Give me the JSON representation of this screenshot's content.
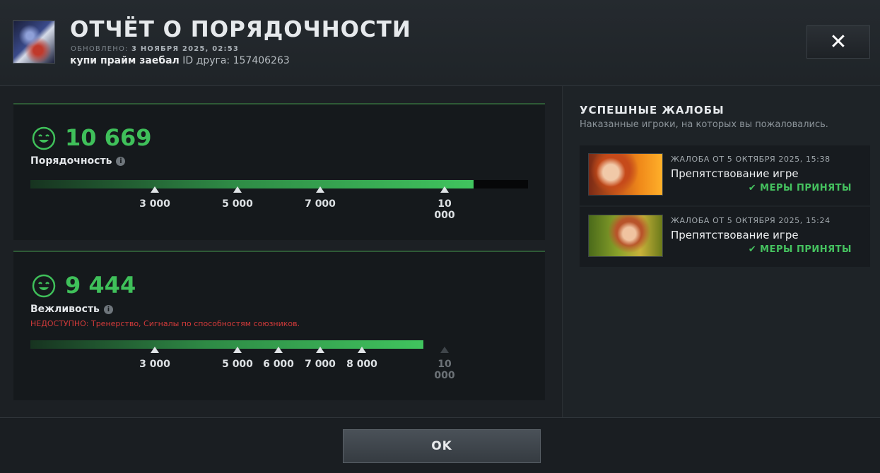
{
  "header": {
    "title": "ОТЧЁТ О ПОРЯДОЧНОСТИ",
    "updated_label": "ОБНОВЛЕНО:",
    "updated_value": "3 НОЯБРЯ 2025, 02:53",
    "username": "купи прайм заебал",
    "friend_id_label": "ID друга:",
    "friend_id": "157406263",
    "close_icon": "close-icon"
  },
  "conduct": {
    "score": "10 669",
    "label": "Порядочность",
    "progress_fraction": 0.89,
    "ticks": [
      "3 000",
      "5 000",
      "7 000",
      "10 000"
    ],
    "color": "#3fc05a"
  },
  "behavior": {
    "score": "9 444",
    "label": "Вежливость",
    "unavailable": "НЕДОСТУПНО:  Тренерство, Сигналы по способностям союзников.",
    "progress_fraction": 0.79,
    "ticks": [
      "3 000",
      "5 000",
      "6 000",
      "7 000",
      "8 000",
      "10 000"
    ],
    "color": "#3fc05a"
  },
  "reports": {
    "title": "УСПЕШНЫЕ ЖАЛОБЫ",
    "subtitle": "Наказанные игроки, на которых вы пожаловались.",
    "items": [
      {
        "date": "ЖАЛОБА ОТ 5 ОКТЯБРЯ 2025, 15:38",
        "reason": "Препятствование игре",
        "status": "МЕРЫ ПРИНЯТЫ"
      },
      {
        "date": "ЖАЛОБА ОТ 5 ОКТЯБРЯ 2025, 15:24",
        "reason": "Препятствование игре",
        "status": "МЕРЫ ПРИНЯТЫ"
      }
    ]
  },
  "footer": {
    "ok_label": "OK"
  }
}
